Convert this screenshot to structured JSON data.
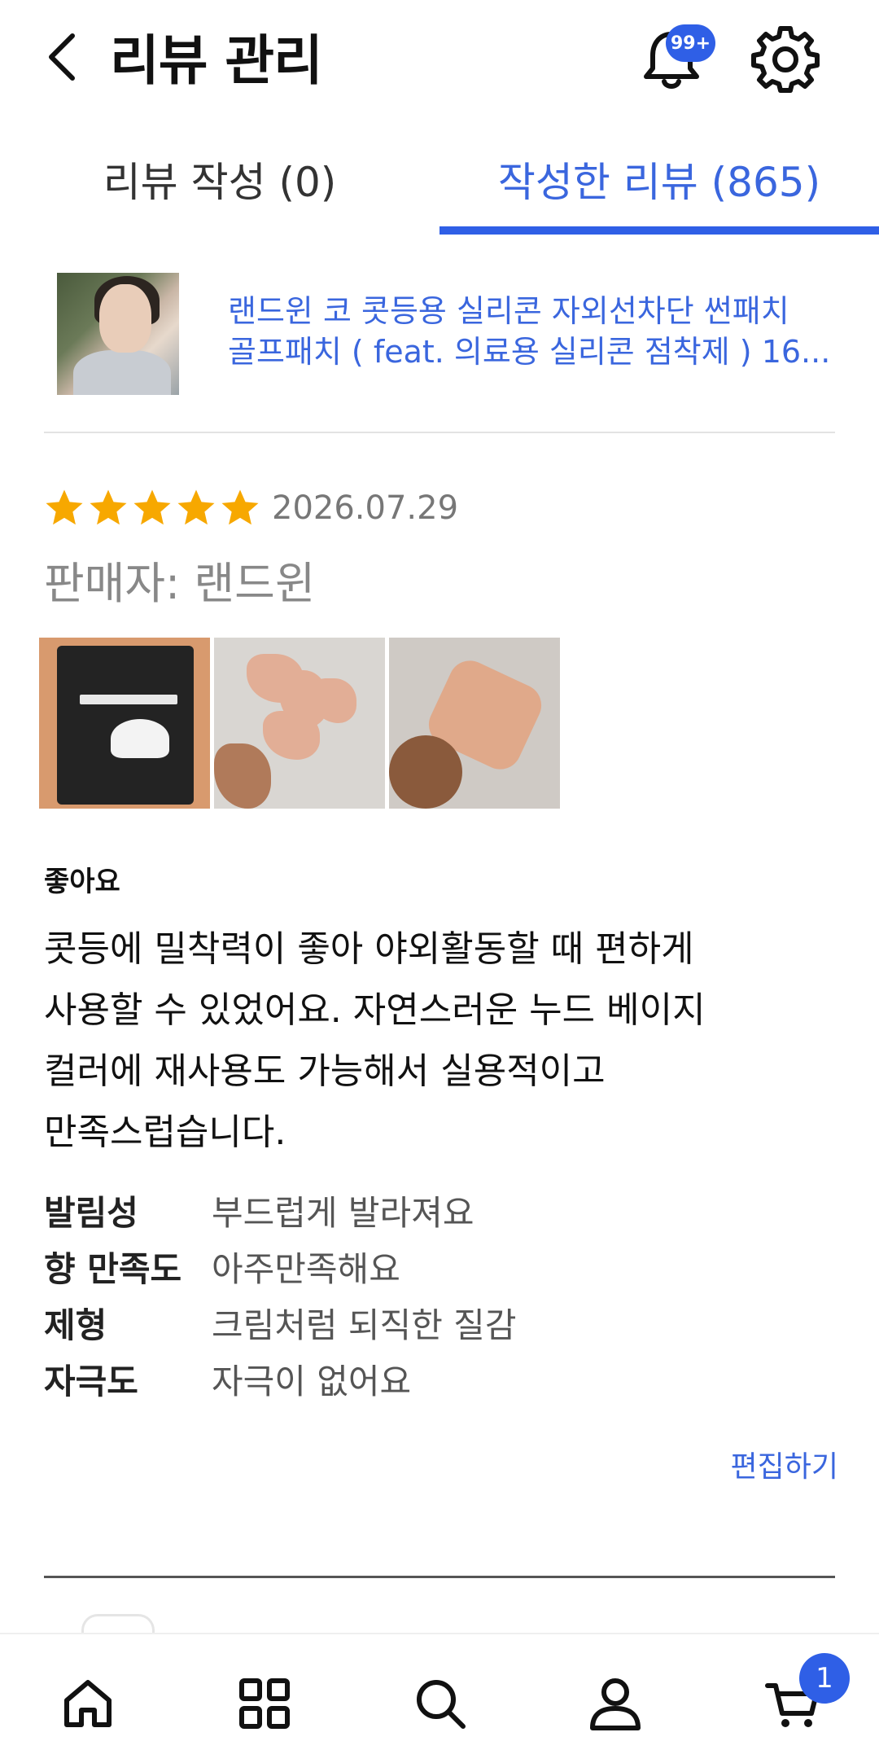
{
  "header": {
    "title": "리뷰 관리",
    "notification_badge": "99+",
    "icons": {
      "back": "back-arrow-icon",
      "bell": "bell-icon",
      "settings": "gear-icon"
    }
  },
  "tabs": [
    {
      "label": "리뷰 작성 (0)",
      "active": false
    },
    {
      "label": "작성한 리뷰 (865)",
      "active": true
    }
  ],
  "product": {
    "name_line1": "랜드윈 코 콧등용 실리콘 자외선차단 썬패치",
    "name_line2": "골프패치 ( feat. 의료용 실리콘 점착제 ) 16..."
  },
  "review": {
    "rating": 5,
    "date": "2026.07.29",
    "seller": "판매자: 랜드윈",
    "photo_count": 3,
    "title": "좋아요",
    "body_lines": [
      "콧등에 밀착력이 좋아 야외활동할 때 편하게",
      "사용할 수 있었어요. 자연스러운 누드 베이지",
      "컬러에 재사용도 가능해서 실용적이고",
      "만족스럽습니다."
    ],
    "attributes": [
      {
        "key": "발림성",
        "value": "부드럽게 발라져요"
      },
      {
        "key": "향 만족도",
        "value": "아주만족해요"
      },
      {
        "key": "제형",
        "value": "크림처럼 되직한 질감"
      },
      {
        "key": "자극도",
        "value": "자극이 없어요"
      }
    ],
    "edit_label": "편집하기"
  },
  "bottom_nav": {
    "items": [
      "home-icon",
      "grid-icon",
      "search-icon",
      "profile-icon",
      "cart-icon"
    ],
    "cart_badge": "1"
  },
  "colors": {
    "accent": "#2f5fe6",
    "link": "#3a66de",
    "star": "#f7a800"
  }
}
